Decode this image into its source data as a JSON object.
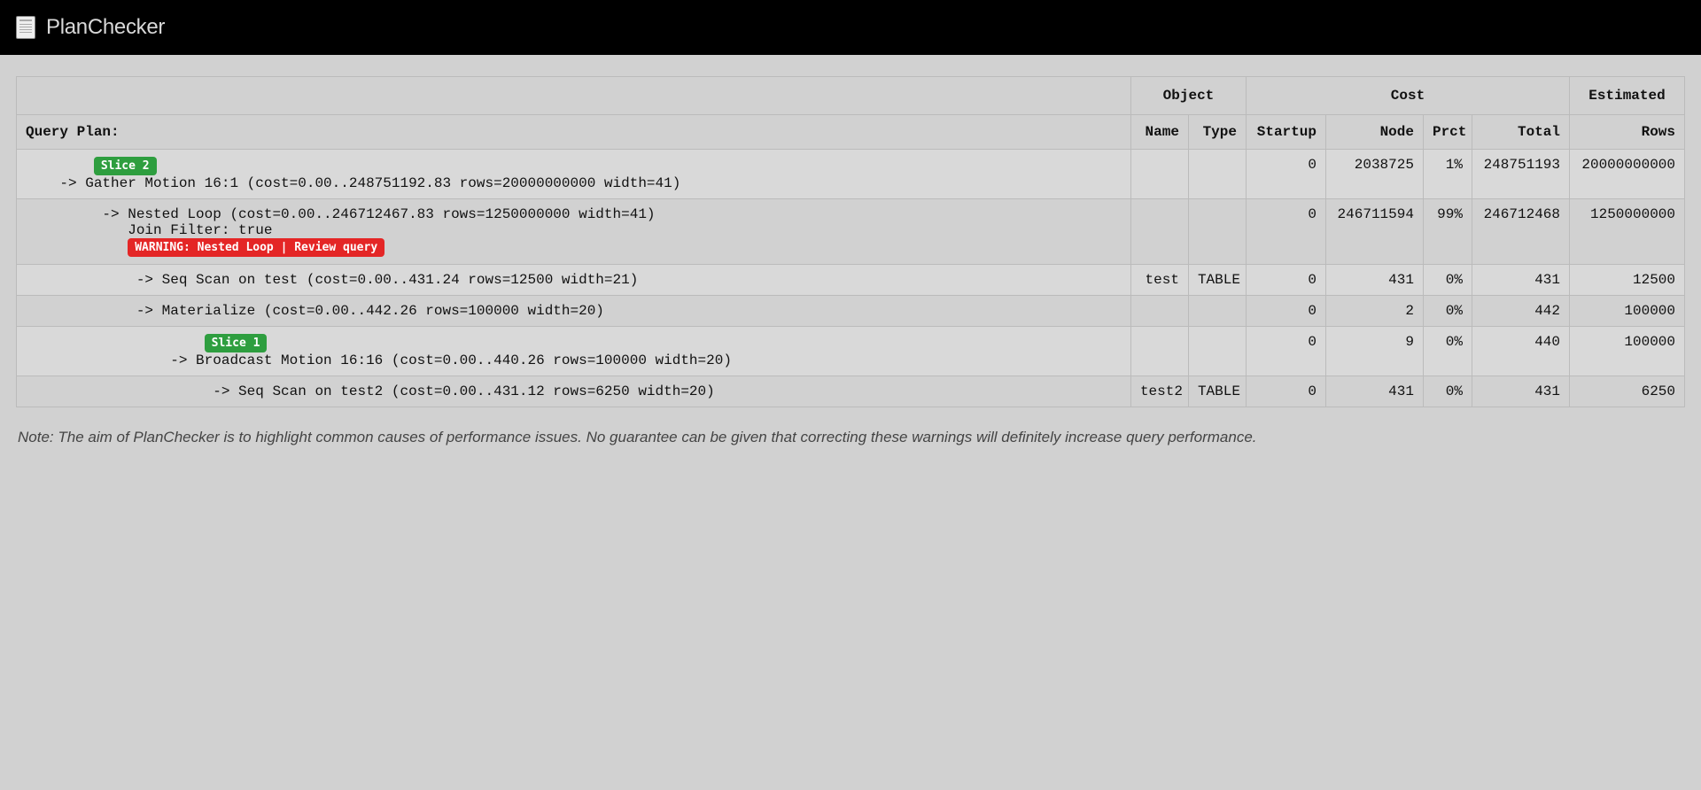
{
  "app": {
    "title": "PlanChecker"
  },
  "headers": {
    "group_object": "Object",
    "group_cost": "Cost",
    "group_estimated": "Estimated",
    "query_plan": "Query Plan:",
    "name": "Name",
    "type": "Type",
    "startup": "Startup",
    "node": "Node",
    "prct": "Prct",
    "total": "Total",
    "rows": "Rows"
  },
  "rows": [
    {
      "indent": 4,
      "slice": "Slice 2",
      "slice_indent": 8,
      "text": "-> Gather Motion 16:1 (cost=0.00..248751192.83 rows=20000000000 width=41)",
      "name": "",
      "type": "",
      "startup": "0",
      "node": "2038725",
      "prct": "1%",
      "total": "248751193",
      "rows": "20000000000"
    },
    {
      "indent": 9,
      "text": "-> Nested Loop (cost=0.00..246712467.83 rows=1250000000 width=41)",
      "sub_indent": 12,
      "subtext": "Join Filter: true",
      "warning": "WARNING: Nested Loop | Review query",
      "warning_indent": 12,
      "name": "",
      "type": "",
      "startup": "0",
      "node": "246711594",
      "prct": "99%",
      "total": "246712468",
      "rows": "1250000000"
    },
    {
      "indent": 13,
      "text": "-> Seq Scan on test (cost=0.00..431.24 rows=12500 width=21)",
      "name": "test",
      "type": "TABLE",
      "startup": "0",
      "node": "431",
      "prct": "0%",
      "total": "431",
      "rows": "12500"
    },
    {
      "indent": 13,
      "text": "-> Materialize (cost=0.00..442.26 rows=100000 width=20)",
      "name": "",
      "type": "",
      "startup": "0",
      "node": "2",
      "prct": "0%",
      "total": "442",
      "rows": "100000"
    },
    {
      "indent": 17,
      "slice": "Slice 1",
      "slice_indent": 21,
      "text": "-> Broadcast Motion 16:16 (cost=0.00..440.26 rows=100000 width=20)",
      "name": "",
      "type": "",
      "startup": "0",
      "node": "9",
      "prct": "0%",
      "total": "440",
      "rows": "100000"
    },
    {
      "indent": 22,
      "text": "-> Seq Scan on test2 (cost=0.00..431.12 rows=6250 width=20)",
      "name": "test2",
      "type": "TABLE",
      "startup": "0",
      "node": "431",
      "prct": "0%",
      "total": "431",
      "rows": "6250"
    }
  ],
  "note": "Note: The aim of PlanChecker is to highlight common causes of performance issues. No guarantee can be given that correcting these warnings will definitely increase query performance."
}
